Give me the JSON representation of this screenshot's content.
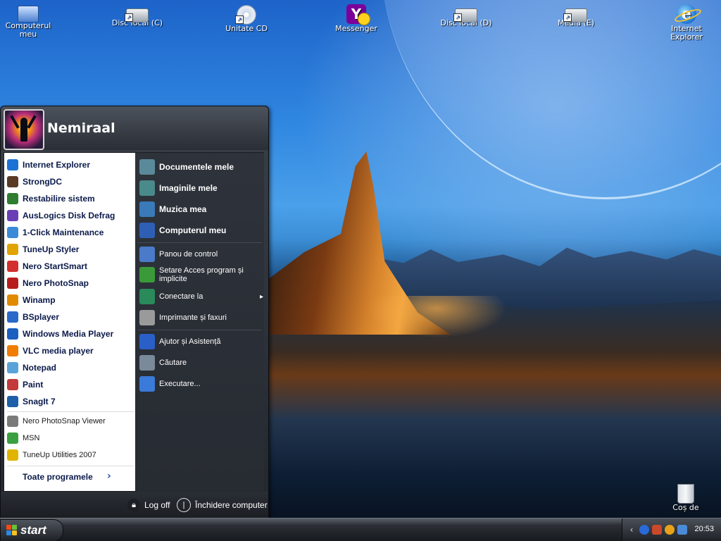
{
  "desktop": {
    "icons": [
      {
        "label": "Computerul meu",
        "icon": "computer-icon"
      },
      {
        "label": "Disc local (C)",
        "icon": "local-disk-icon"
      },
      {
        "label": "Unitate CD",
        "icon": "cd-drive-icon"
      },
      {
        "label": "Messenger",
        "icon": "yahoo-messenger-icon"
      },
      {
        "label": "Disc local (D)",
        "icon": "local-disk-icon"
      },
      {
        "label": "Media  (E)",
        "icon": "local-disk-icon"
      },
      {
        "label": "Internet Explorer",
        "icon": "internet-explorer-icon"
      },
      {
        "label": "Coș de",
        "icon": "recycle-bin-icon"
      }
    ]
  },
  "start_menu": {
    "username": "Nemiraal",
    "left_pinned": [
      {
        "label": "Internet Explorer",
        "icon": "internet-explorer-icon",
        "color": "#1a72d4"
      },
      {
        "label": "StrongDC",
        "icon": "strongdc-icon",
        "color": "#5a3a24"
      },
      {
        "label": "Restabilire sistem",
        "icon": "system-restore-icon",
        "color": "#2e7d32"
      },
      {
        "label": "AusLogics Disk Defrag",
        "icon": "disk-defrag-icon",
        "color": "#6a3fb5"
      },
      {
        "label": "1-Click Maintenance",
        "icon": "maintenance-icon",
        "color": "#3a8ad8"
      },
      {
        "label": "TuneUp Styler",
        "icon": "tuneup-styler-icon",
        "color": "#e0a400"
      },
      {
        "label": "Nero StartSmart",
        "icon": "nero-startsmart-icon",
        "color": "#d32f2f"
      },
      {
        "label": "Nero PhotoSnap",
        "icon": "nero-photosnap-icon",
        "color": "#b71c1c"
      },
      {
        "label": "Winamp",
        "icon": "winamp-icon",
        "color": "#e08a00"
      },
      {
        "label": "BSplayer",
        "icon": "bsplayer-icon",
        "color": "#2a6ac8"
      },
      {
        "label": "Windows Media Player",
        "icon": "windows-media-player-icon",
        "color": "#1b5fbf"
      },
      {
        "label": "VLC media player",
        "icon": "vlc-icon",
        "color": "#f07c00"
      },
      {
        "label": "Notepad",
        "icon": "notepad-icon",
        "color": "#5aa3d8"
      },
      {
        "label": "Paint",
        "icon": "paint-icon",
        "color": "#c23a3a"
      },
      {
        "label": "SnagIt 7",
        "icon": "snagit-icon",
        "color": "#1d5fa8"
      }
    ],
    "left_recent": [
      {
        "label": "Nero PhotoSnap Viewer",
        "icon": "nero-photosnap-viewer-icon",
        "color": "#7a7a7a"
      },
      {
        "label": "MSN",
        "icon": "msn-icon",
        "color": "#3aa040"
      },
      {
        "label": "TuneUp Utilities 2007",
        "icon": "tuneup-utilities-icon",
        "color": "#e0b400"
      }
    ],
    "all_programs": "Toate programele",
    "right_main": [
      {
        "label": "Documentele mele",
        "icon": "my-documents-icon",
        "color": "#5a8a9a"
      },
      {
        "label": "Imaginile mele",
        "icon": "my-pictures-icon",
        "color": "#4a8a8a"
      },
      {
        "label": "Muzica mea",
        "icon": "my-music-icon",
        "color": "#3a7ab8"
      },
      {
        "label": "Computerul meu",
        "icon": "my-computer-icon",
        "color": "#2e5fb5"
      }
    ],
    "right_system": [
      {
        "label": "Panou de control",
        "icon": "control-panel-icon",
        "color": "#4a7ac8"
      },
      {
        "label": "Setare Acces program și implicite",
        "icon": "set-program-access-icon",
        "color": "#3a9a3a"
      },
      {
        "label": "Conectare la",
        "icon": "connect-to-icon",
        "color": "#2a8a5a",
        "has_submenu": true
      },
      {
        "label": "Imprimante și faxuri",
        "icon": "printers-faxes-icon",
        "color": "#9a9a9a"
      }
    ],
    "right_help": [
      {
        "label": "Ajutor și Asistență",
        "icon": "help-icon",
        "color": "#2a5fc8"
      },
      {
        "label": "Căutare",
        "icon": "search-icon",
        "color": "#7a8a9a"
      },
      {
        "label": "Executare...",
        "icon": "run-icon",
        "color": "#3a7ad8"
      }
    ],
    "footer": {
      "log_off": "Log off",
      "shutdown": "Închidere computer"
    }
  },
  "taskbar": {
    "start_label": "start",
    "clock": "20:53",
    "tray_icons": [
      "show-hidden-icon",
      "network-globe-icon",
      "tray-app-icon",
      "tray-app-icon-2",
      "network-connection-icon"
    ]
  }
}
